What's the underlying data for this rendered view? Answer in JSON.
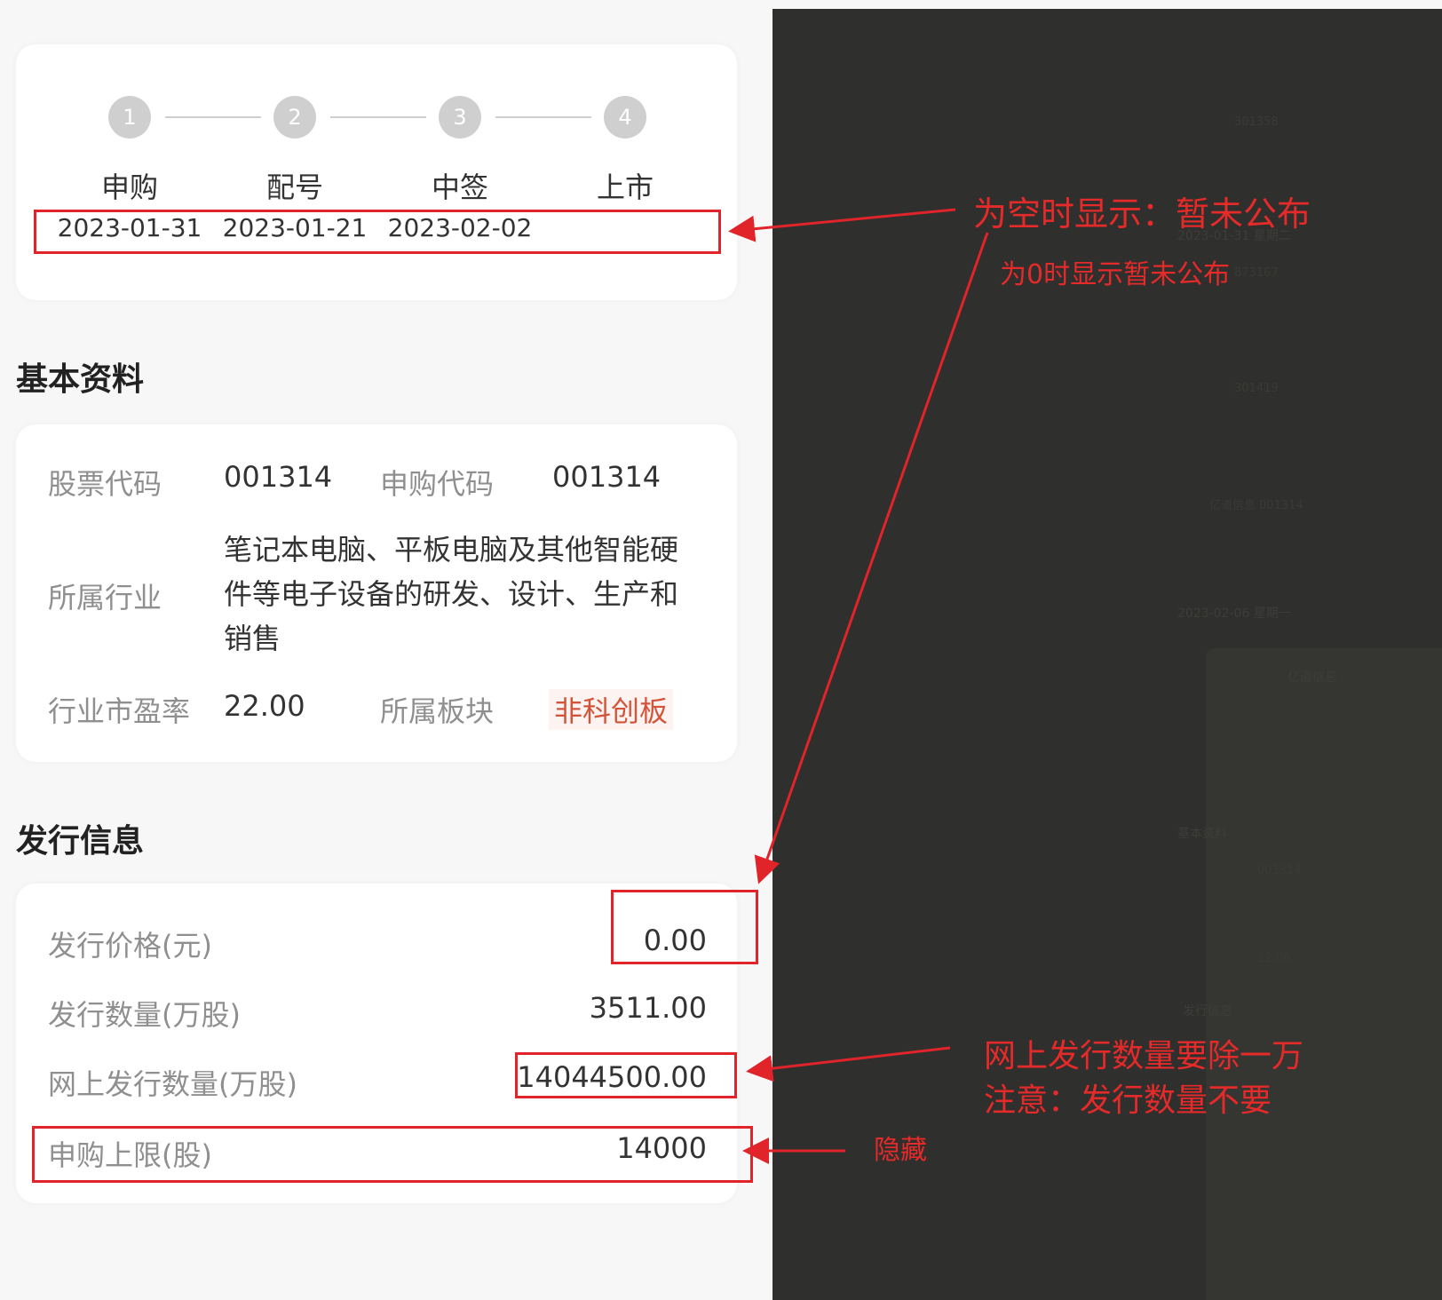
{
  "steps": [
    {
      "num": "1",
      "label": "申购",
      "date": "2023-01-31"
    },
    {
      "num": "2",
      "label": "配号",
      "date": "2023-01-21"
    },
    {
      "num": "3",
      "label": "中签",
      "date": "2023-02-02"
    },
    {
      "num": "4",
      "label": "上市",
      "date": ""
    }
  ],
  "basic": {
    "title": "基本资料",
    "stock_code_label": "股票代码",
    "stock_code": "001314",
    "subscribe_code_label": "申购代码",
    "subscribe_code": "001314",
    "industry_label": "所属行业",
    "industry": "笔记本电脑、平板电脑及其他智能硬件等电子设备的研发、设计、生产和销售",
    "pe_label": "行业市盈率",
    "pe": "22.00",
    "board_label": "所属板块",
    "board": "非科创板"
  },
  "issue": {
    "title": "发行信息",
    "price_label": "发行价格(元)",
    "price": "0.00",
    "qty_label": "发行数量(万股)",
    "qty": "3511.00",
    "online_qty_label": "网上发行数量(万股)",
    "online_qty": "14044500.00",
    "limit_label": "申购上限(股)",
    "limit": "14000"
  },
  "annotations": {
    "empty_note": "为空时显示：暂未公布",
    "zero_note": "为0时显示暂未公布",
    "divide_note": "网上发行数量要除一万",
    "qty_note": "注意：发行数量不要",
    "hide_note": "隐藏"
  },
  "background_screen": {
    "date1": "2023-01-31 星期二",
    "date2": "2023-02-06 星期一",
    "item1": "301358",
    "item2": "873167",
    "item3": "301419",
    "item4": "亿道信息 001314",
    "detail_title": "亿道信息",
    "mini_basic": "基本资料",
    "mini_code": "001314",
    "mini_pe": "22.00",
    "mini_issue": "发行信息"
  },
  "colors": {
    "annotation": "#e0242a",
    "board": "#d2553b",
    "dark_bg": "#2f2f2d"
  }
}
